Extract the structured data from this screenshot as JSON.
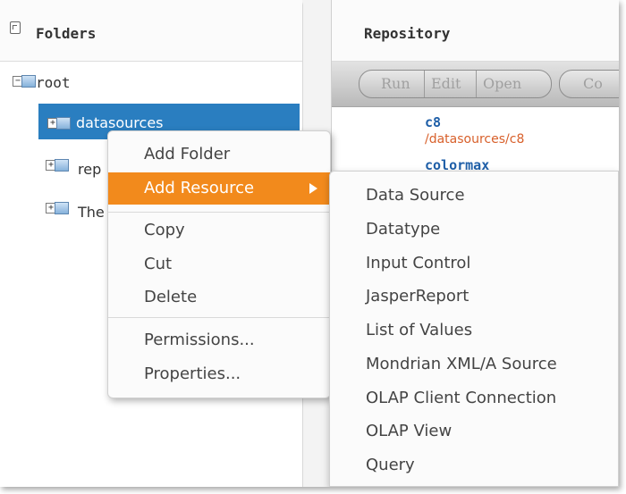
{
  "folders": {
    "title": "Folders",
    "tree": {
      "root_label": "root",
      "selected_label": "datasources",
      "item_rep_label": "rep",
      "item_the_label": "The"
    }
  },
  "repository": {
    "title": "Repository",
    "toolbar": {
      "run_label": "Run",
      "edit_label": "Edit",
      "open_label": "Open",
      "copy_label": "Co"
    },
    "resources": [
      {
        "name": "c8",
        "path": "/datasources/c8"
      },
      {
        "name": "colormax"
      }
    ]
  },
  "context_menu": {
    "add_folder": "Add Folder",
    "add_resource": "Add Resource",
    "copy": "Copy",
    "cut": "Cut",
    "delete": "Delete",
    "permissions": "Permissions...",
    "properties": "Properties..."
  },
  "submenu": {
    "items": [
      "Data Source",
      "Datatype",
      "Input Control",
      "JasperReport",
      "List of Values",
      "Mondrian XML/A Source",
      "OLAP Client Connection",
      "OLAP View",
      "Query"
    ]
  },
  "colors": {
    "selection": "#2a7ec0",
    "menu_highlight": "#f28a1c",
    "resource_name": "#1f5fa8",
    "resource_path": "#d8602b"
  },
  "icons": [
    "panel-collapse-icon",
    "folder-icon",
    "expand-plus-icon",
    "collapse-minus-icon",
    "submenu-arrow-icon"
  ]
}
